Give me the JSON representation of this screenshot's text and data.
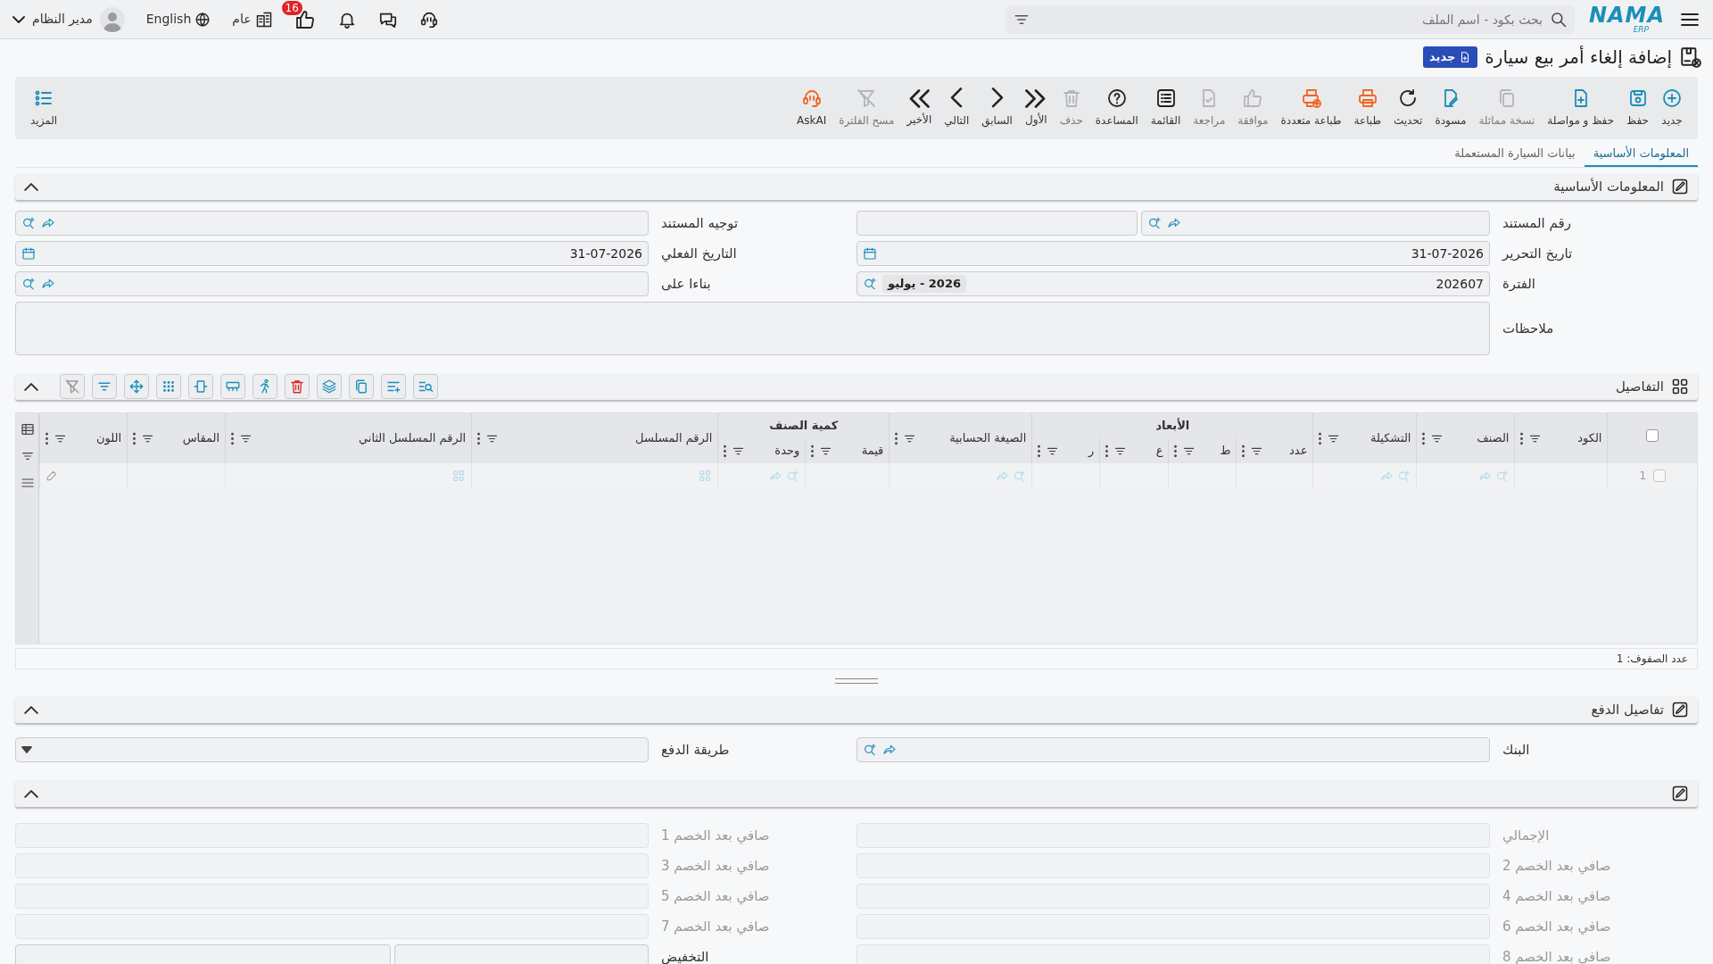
{
  "topbar": {
    "logo": "NAMA",
    "logo_sub": "ERP",
    "search_placeholder": "بحث بكود - اسم الملف",
    "notifications": "16",
    "company": "عام",
    "language": "English",
    "user": "مدير النظام"
  },
  "title": "إضافة إلغاء أمر بيع سيارة",
  "status_badge": "جديد",
  "toolbar": [
    {
      "kind": "new",
      "label": "جديد",
      "color": "#1c8fb8",
      "disabled": false
    },
    {
      "kind": "save",
      "label": "حفظ",
      "color": "#1c8fb8",
      "disabled": false
    },
    {
      "kind": "save-continue",
      "label": "حفظ و مواصلة",
      "color": "#1c8fb8",
      "disabled": false
    },
    {
      "kind": "duplicate",
      "label": "نسخة مماثلة",
      "disabled": true
    },
    {
      "kind": "draft",
      "label": "مسودة",
      "color": "#1c8fb8",
      "disabled": false
    },
    {
      "kind": "refresh",
      "label": "تحديث",
      "color": "#222222",
      "disabled": false
    },
    {
      "kind": "print",
      "label": "طباعة",
      "color": "#f26522",
      "disabled": false
    },
    {
      "kind": "print-multi",
      "label": "طباعة متعددة",
      "color": "#f26522",
      "disabled": false
    },
    {
      "kind": "approve",
      "label": "موافقة",
      "disabled": true
    },
    {
      "kind": "review",
      "label": "مراجعة",
      "disabled": true
    },
    {
      "kind": "list",
      "label": "القائمة",
      "color": "#222222",
      "disabled": false
    },
    {
      "kind": "help",
      "label": "المساعدة",
      "color": "#222222",
      "disabled": false
    },
    {
      "kind": "delete",
      "label": "حذف",
      "disabled": true
    },
    {
      "kind": "first",
      "label": "الأول",
      "color": "#222222",
      "disabled": false
    },
    {
      "kind": "prev",
      "label": "السابق",
      "color": "#222222",
      "disabled": false
    },
    {
      "kind": "next",
      "label": "التالي",
      "color": "#222222",
      "disabled": false
    },
    {
      "kind": "last",
      "label": "الأخير",
      "color": "#222222",
      "disabled": false
    },
    {
      "kind": "clear-filter",
      "label": "مسح الفلترة",
      "disabled": true
    },
    {
      "kind": "ask-ai",
      "label": "AskAI",
      "color": "#f26522",
      "disabled": false
    }
  ],
  "more": {
    "label": "المزيد"
  },
  "tabs": [
    {
      "label": "المعلومات الأساسية",
      "selected": true
    },
    {
      "label": "بيانات السيارة المستعملة",
      "selected": false
    }
  ],
  "basic_info": {
    "title": "المعلومات الأساسية",
    "expanded": true,
    "fields": [
      {
        "label": "رقم المستند",
        "kind": "split-lookup"
      },
      {
        "label": "توجيه المستند",
        "kind": "lookup"
      },
      {
        "label": "تاريخ التحرير",
        "kind": "date",
        "value": "31-07-2026"
      },
      {
        "label": "التاريخ الفعلي",
        "kind": "date",
        "value": "31-07-2026"
      },
      {
        "label": "الفترة",
        "kind": "period",
        "value": "202607",
        "tag": "2026 - يوليو"
      },
      {
        "label": "بناءا على",
        "kind": "lookup"
      },
      {
        "label": "ملاحظات",
        "kind": "notes"
      }
    ]
  },
  "details": {
    "title": "التفاصيل",
    "expanded": true,
    "select_all": {
      "checked": false
    },
    "columns": [
      {
        "label": "الكود",
        "kind": "empty"
      },
      {
        "label": "الصنف",
        "kind": "lookup"
      },
      {
        "label": "التشكيلة",
        "kind": "lookup"
      },
      {
        "label": "الأبعاد",
        "children": [
          {
            "label": "عدد",
            "kind": "empty"
          },
          {
            "label": "ط",
            "kind": "empty"
          },
          {
            "label": "ع",
            "kind": "empty"
          },
          {
            "label": "ر",
            "kind": "empty"
          }
        ]
      },
      {
        "label": "الصيغة الحسابية",
        "kind": "lookup"
      },
      {
        "label": "كمية الصنف",
        "children": [
          {
            "label": "قيمة",
            "kind": "empty"
          },
          {
            "label": "وحدة",
            "kind": "lookup"
          }
        ]
      },
      {
        "label": "الرقم المسلسل",
        "kind": "serial"
      },
      {
        "label": "الرقم المسلسل الثاني",
        "kind": "serial"
      },
      {
        "label": "المقاس",
        "kind": "empty"
      },
      {
        "label": "اللون",
        "kind": "edit"
      }
    ],
    "rows": [
      {
        "number": "1",
        "checked": false
      }
    ],
    "row_count": "عدد الصفوف: 1"
  },
  "payment": {
    "title": "تفاصيل الدفع",
    "expanded": true,
    "fields": [
      {
        "label": "البنك",
        "kind": "lookup"
      },
      {
        "label": "طريقة الدفع",
        "kind": "select"
      }
    ]
  },
  "totals": {
    "expanded": true,
    "fields": [
      {
        "label": "الإجمالي",
        "kind": "text",
        "disabled": true
      },
      {
        "label": "صافي بعد الخصم 1",
        "kind": "text",
        "disabled": true
      },
      {
        "label": "صافي بعد الخصم 2",
        "kind": "text",
        "disabled": true
      },
      {
        "label": "صافي بعد الخصم 3",
        "kind": "text",
        "disabled": true
      },
      {
        "label": "صافي بعد الخصم 4",
        "kind": "text",
        "disabled": true
      },
      {
        "label": "صافي بعد الخصم 5",
        "kind": "text",
        "disabled": true
      },
      {
        "label": "صافي بعد الخصم 6",
        "kind": "text",
        "disabled": true
      },
      {
        "label": "صافي بعد الخصم 7",
        "kind": "text",
        "disabled": true
      },
      {
        "label": "صافي بعد الخصم 8",
        "kind": "text",
        "disabled": true
      },
      {
        "label": "التخفيض",
        "kind": "split",
        "disabled": false
      }
    ]
  }
}
